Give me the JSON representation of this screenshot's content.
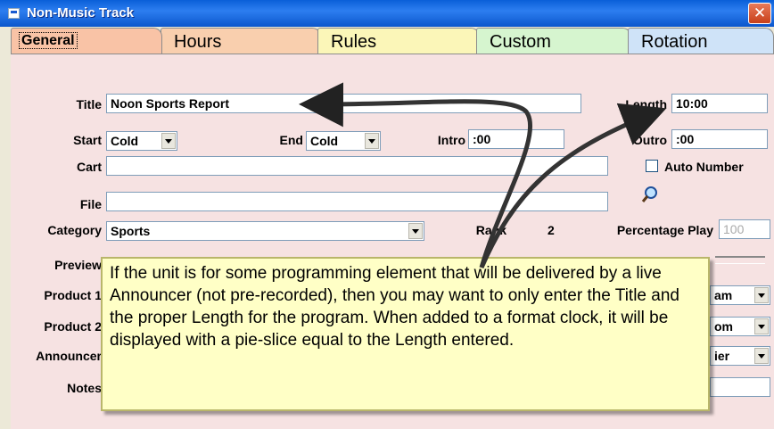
{
  "window": {
    "title": "Non-Music Track",
    "close_label": "✕"
  },
  "tabs": [
    {
      "label": "General"
    },
    {
      "label": "Hours"
    },
    {
      "label": "Rules"
    },
    {
      "label": "Custom"
    },
    {
      "label": "Rotation"
    }
  ],
  "form": {
    "title_label": "Title",
    "title_value": "Noon Sports Report",
    "length_label": "Length",
    "length_value": "10:00",
    "start_label": "Start",
    "start_value": "Cold",
    "end_label": "End",
    "end_value": "Cold",
    "intro_label": "Intro",
    "intro_value": ":00",
    "outro_label": "Outro",
    "outro_value": ":00",
    "cart_label": "Cart",
    "cart_value": "",
    "auto_number_label": "Auto Number",
    "file_label": "File",
    "file_value": "",
    "category_label": "Category",
    "category_value": "Sports",
    "rank_label": "Rank",
    "rank_value": "2",
    "percentage_play_label": "Percentage Play",
    "percentage_play_value": "100",
    "preview_label": "Preview",
    "product1_label": "Product 1",
    "product2_label": "Product 2",
    "announcer_label": "Announcer",
    "notes_label": "Notes",
    "product1_select_partial": "am",
    "product2_select_partial": "om",
    "announcer_select_partial": "ier"
  },
  "callout": {
    "text": "If the unit is for some programming element that will be delivered by a live Announcer (not pre-recorded), then you may want to only enter the Title and the proper Length for the program.  When added to a format clock, it will be displayed with a pie-slice equal to the Length entered."
  },
  "icons": {
    "window_icon": "window-icon",
    "search": "magnifier-icon",
    "close": "close-icon",
    "dropdown": "chevron-down-icon"
  },
  "colors": {
    "titlebar": "#0a5fd8",
    "panel": "#f6e2e2",
    "callout_bg": "#ffffc6",
    "tab_general": "#f9c3a6",
    "tab_hours": "#f9cfae",
    "tab_rules": "#fbf6b8",
    "tab_custom": "#d6f5cf",
    "tab_rotation": "#cfe3f8"
  }
}
